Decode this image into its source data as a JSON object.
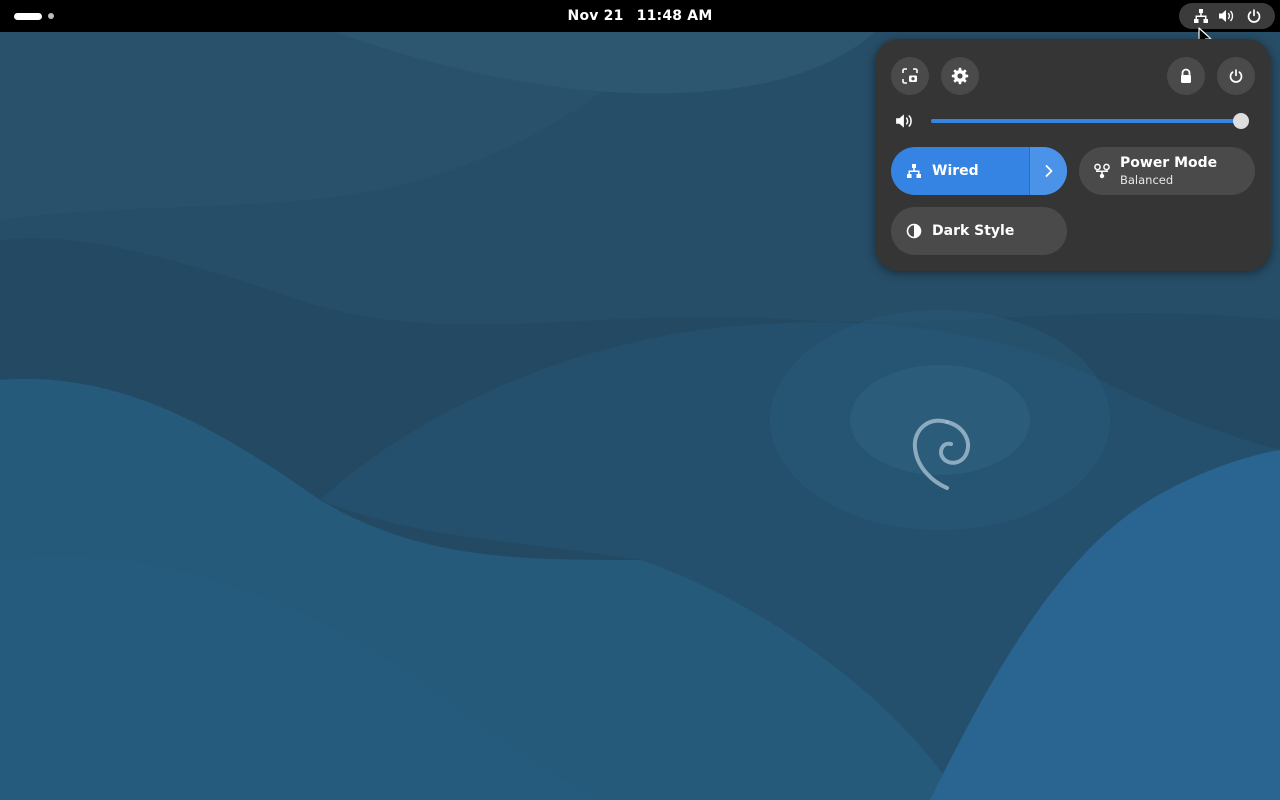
{
  "topbar": {
    "date": "Nov 21",
    "time": "11:48 AM",
    "status_icons": [
      "network-wired-icon",
      "volume-icon",
      "power-icon"
    ]
  },
  "quick_settings": {
    "top_buttons": {
      "screenshot_icon": "screenshot-icon",
      "settings_icon": "gear-icon",
      "lock_icon": "lock-icon",
      "power_icon": "power-icon"
    },
    "volume": {
      "icon": "volume-icon",
      "level": 1.0
    },
    "toggles": {
      "wired": {
        "label": "Wired",
        "active": true,
        "icon": "network-wired-icon",
        "has_menu": true
      },
      "power_mode": {
        "label": "Power Mode",
        "sublabel": "Balanced",
        "icon": "power-profile-icon"
      },
      "dark_style": {
        "label": "Dark Style",
        "active": false,
        "icon": "dark-style-icon"
      }
    }
  },
  "colors": {
    "accent": "#3584e4",
    "panel": "#353535",
    "button": "#4a4a4a",
    "wallpaper": "#244d66"
  }
}
